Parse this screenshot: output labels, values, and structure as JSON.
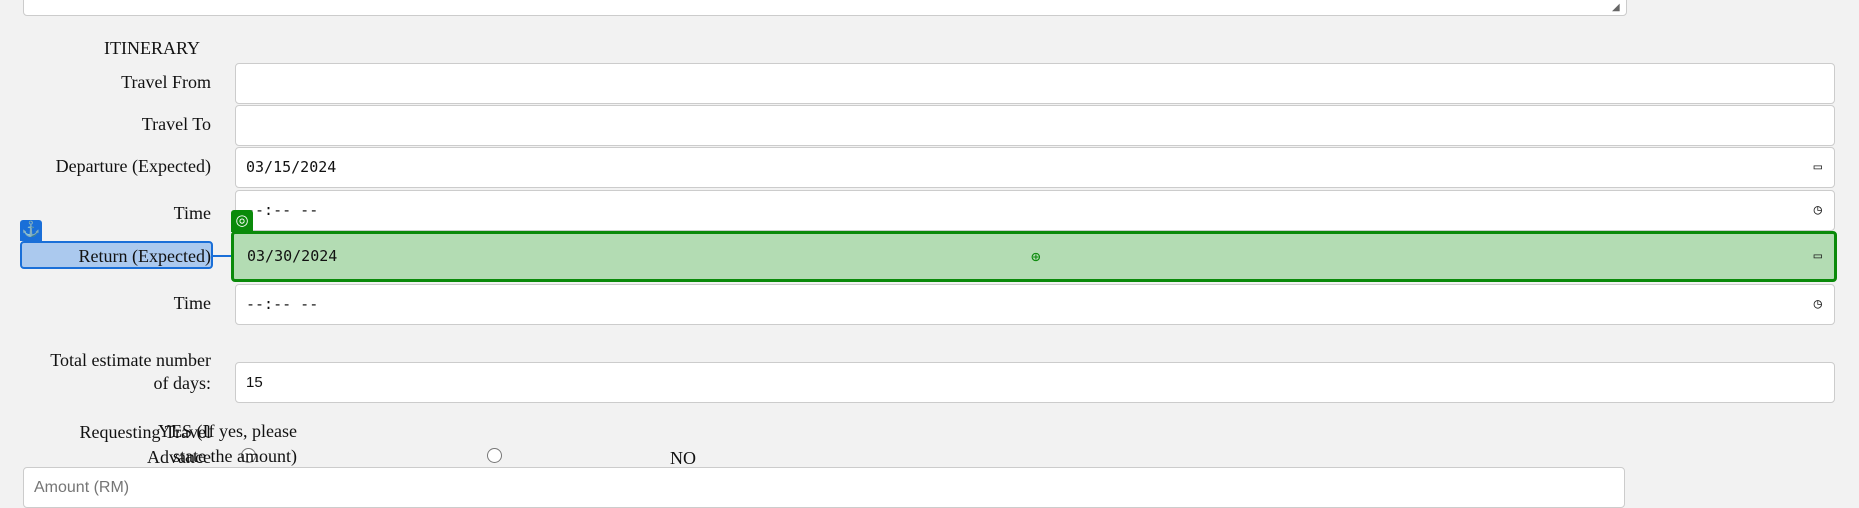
{
  "section_title": "ITINERARY",
  "fields": [
    {
      "label": "Travel From",
      "value": ""
    },
    {
      "label": "Travel To",
      "value": ""
    },
    {
      "label": "Departure (Expected)",
      "value": "03/15/2024",
      "icon": "calendar-icon"
    },
    {
      "label": "Time",
      "value": "--:-- --",
      "icon": "clock-icon"
    },
    {
      "label": "Return (Expected)",
      "value": "03/30/2024",
      "icon": "calendar-icon"
    },
    {
      "label": "Time",
      "value": "--:-- --",
      "icon": "clock-icon"
    }
  ],
  "days": {
    "label_1": "Total estimate number",
    "label_2": "of days:",
    "value": "15"
  },
  "advance": {
    "label_1": "Requesting Travel",
    "label_2": "Advance",
    "yes_1": "YES (If yes, please",
    "yes_2": "state the amount)",
    "no": "NO"
  },
  "amount": {
    "placeholder": "Amount (RM)"
  },
  "overlay": {
    "highlight_color": "#b3dcb3",
    "anchor_color": "#1a6fd8",
    "target_color": "#0a8a0a"
  }
}
